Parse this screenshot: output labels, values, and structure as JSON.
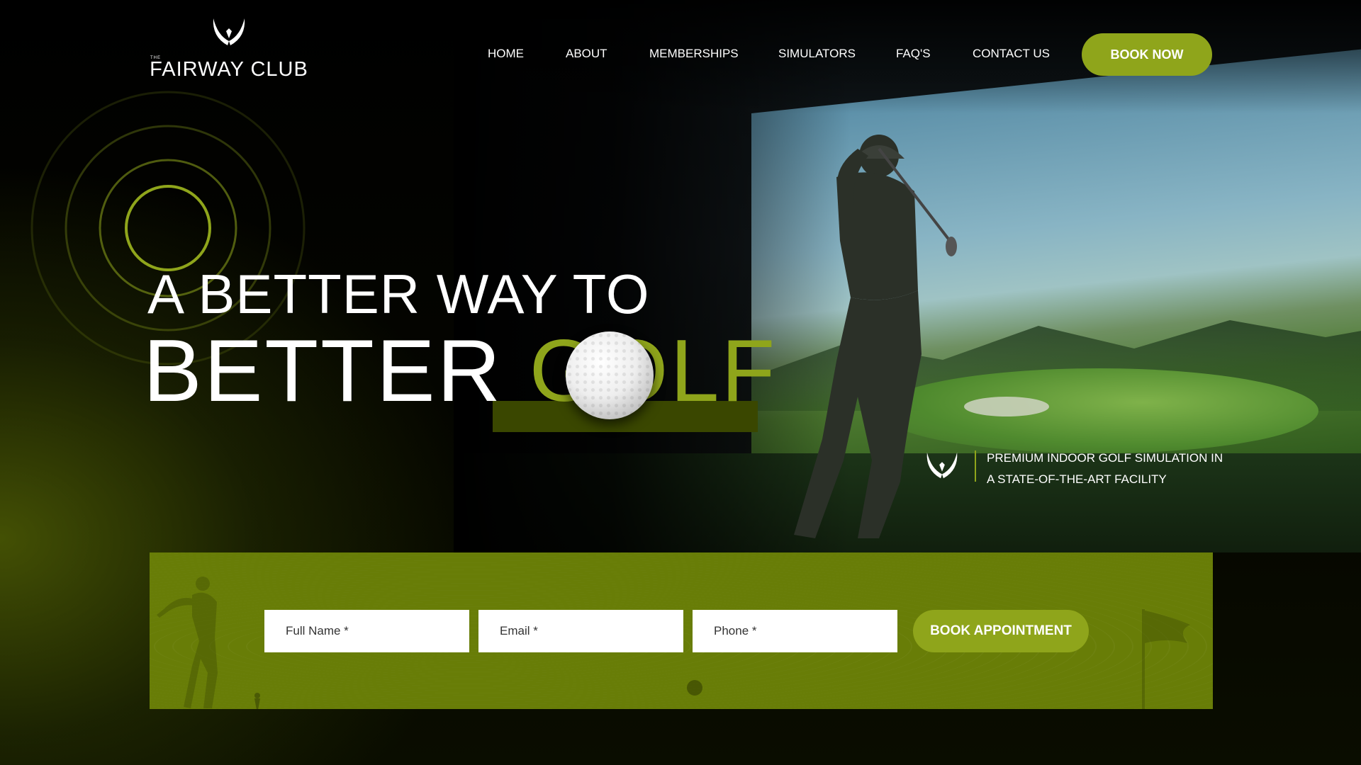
{
  "brand": {
    "the": "THE",
    "name": "FAIRWAY CLUB",
    "logo_icon": "wing-crest-icon"
  },
  "nav": {
    "items": [
      {
        "label": "HOME"
      },
      {
        "label": "ABOUT"
      },
      {
        "label": "MEMBERSHIPS"
      },
      {
        "label": "SIMULATORS"
      },
      {
        "label": "FAQ'S"
      },
      {
        "label": "CONTACT US"
      }
    ],
    "cta": "BOOK NOW"
  },
  "hero": {
    "line1": "A BETTER WAY TO",
    "line2_white": "BETTER ",
    "line2_accent": "GOLF",
    "tagline_line1": "PREMIUM INDOOR GOLF SIMULATION IN",
    "tagline_line2": "A STATE-OF-THE-ART FACILITY"
  },
  "booking": {
    "name_placeholder": "Full Name *",
    "email_placeholder": "Email *",
    "phone_placeholder": "Phone *",
    "submit": "BOOK APPOINTMENT"
  },
  "colors": {
    "accent": "#8fa51b",
    "band": "#687d07",
    "background": "#000000"
  }
}
